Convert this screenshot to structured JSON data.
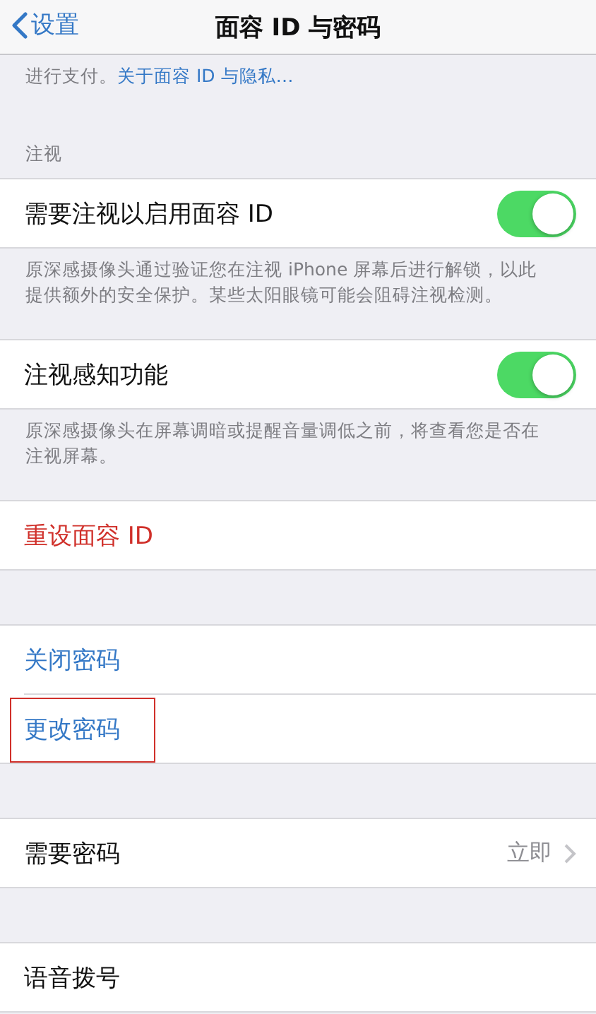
{
  "nav": {
    "back": "设置",
    "title": "面容 ID 与密码"
  },
  "blocks": [
    {
      "kind": "footer",
      "text": "进行支付。",
      "link": "关于面容 ID 与隐私…"
    },
    {
      "kind": "header",
      "text": "注视"
    },
    {
      "kind": "group",
      "rows": [
        {
          "kind": "toggle",
          "label": "需要注视以启用面容 ID",
          "on": true
        }
      ]
    },
    {
      "kind": "footer",
      "text": "原深感摄像头通过验证您在注视 iPhone 屏幕后进行解锁，以此提供额外的安全保护。某些太阳眼镜可能会阻碍注视检测。"
    },
    {
      "kind": "group",
      "rows": [
        {
          "kind": "toggle",
          "label": "注视感知功能",
          "on": true
        }
      ]
    },
    {
      "kind": "footer",
      "text": "原深感摄像头在屏幕调暗或提醒音量调低之前，将查看您是否在注视屏幕。"
    },
    {
      "kind": "group",
      "rows": [
        {
          "kind": "destructive",
          "label": "重设面容 ID",
          "highlighted": false
        }
      ]
    },
    {
      "kind": "group",
      "rows": [
        {
          "kind": "link",
          "label": "关闭密码",
          "highlighted": false
        },
        {
          "kind": "link",
          "label": "更改密码",
          "highlighted": true
        }
      ]
    },
    {
      "kind": "group",
      "rows": [
        {
          "kind": "detail",
          "label": "需要密码",
          "value": "立即"
        }
      ]
    },
    {
      "kind": "group",
      "rows": [
        {
          "kind": "plain",
          "label": "语音拨号"
        }
      ]
    }
  ]
}
